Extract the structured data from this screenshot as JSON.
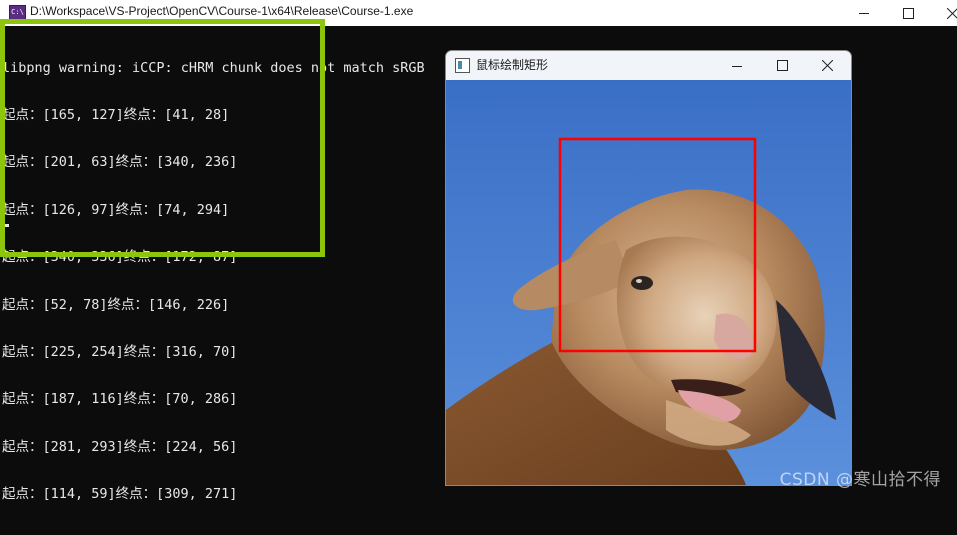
{
  "console": {
    "title": "D:\\Workspace\\VS-Project\\OpenCV\\Course-1\\x64\\Release\\Course-1.exe",
    "icon_text": "C:\\",
    "lines": [
      "libpng warning: iCCP: cHRM chunk does not match sRGB",
      "起点：[165, 127]终点：[41, 28]",
      "起点：[201, 63]终点：[340, 236]",
      "起点：[126, 97]终点：[74, 294]",
      "起点：[340, 336]终点：[172, 87]",
      "起点：[52, 78]终点：[146, 226]",
      "起点：[225, 254]终点：[316, 70]",
      "起点：[187, 116]终点：[70, 286]",
      "起点：[281, 293]终点：[224, 56]",
      "起点：[114, 59]终点：[309, 271]"
    ]
  },
  "highlight_color": "#8dc40c",
  "cv_window": {
    "title": "鼠标绘制矩形",
    "rect_color": "#ff0000",
    "image_subject": "sheep-photo"
  },
  "watermark": "CSDN @寒山拾不得"
}
